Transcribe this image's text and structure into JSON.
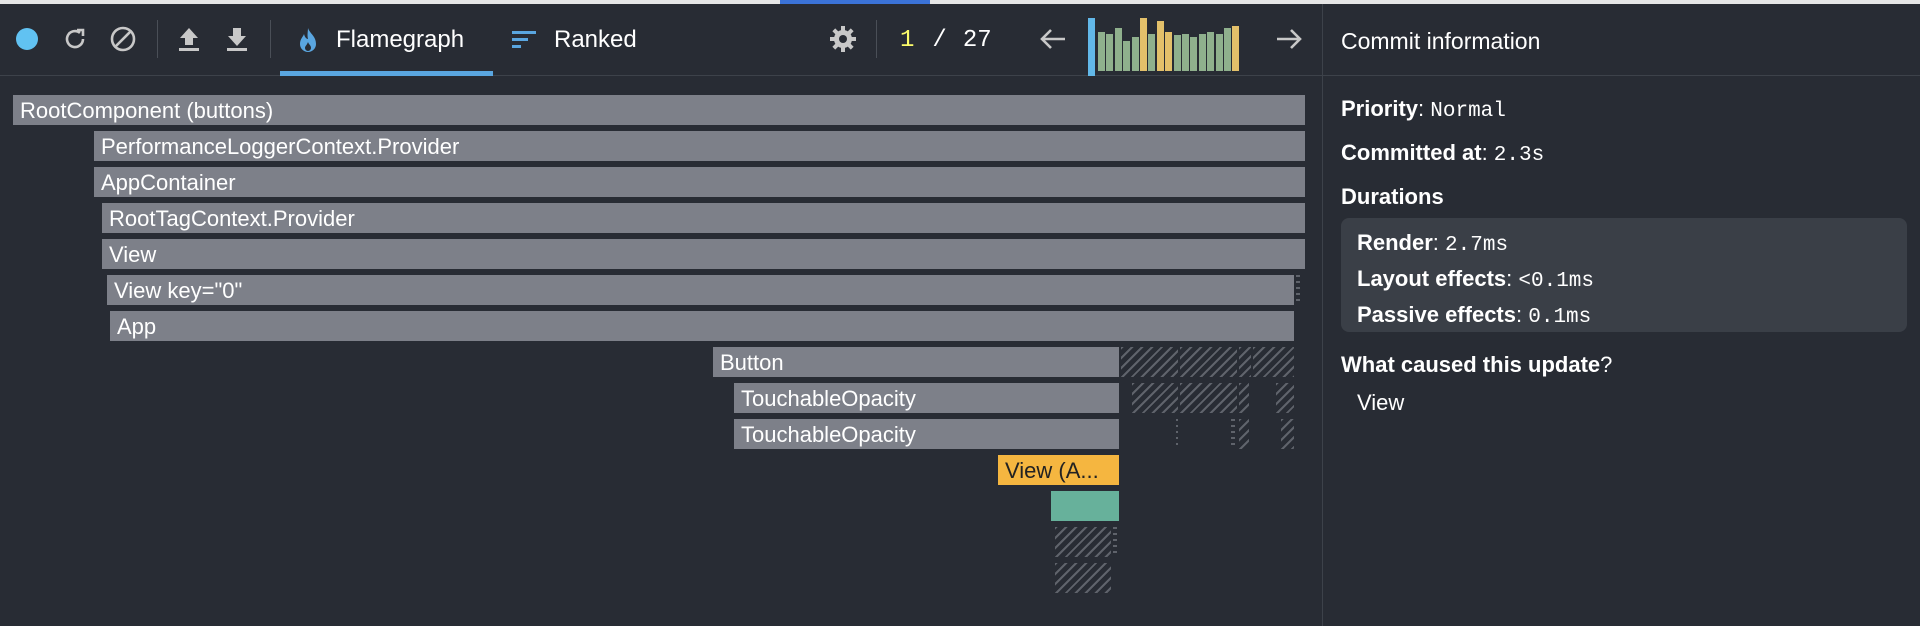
{
  "toolbar": {
    "icons": [
      "record-icon",
      "reload-icon",
      "clear-icon",
      "upload-icon",
      "download-icon",
      "settings-icon",
      "prev-arrow-icon",
      "next-arrow-icon"
    ],
    "tabs": [
      {
        "label": "Flamegraph",
        "icon": "flame-icon",
        "active": true
      },
      {
        "label": "Ranked",
        "icon": "ranked-icon",
        "active": false
      }
    ],
    "commit_current": "1",
    "commit_sep": "/",
    "commit_total": "27"
  },
  "commit_chart": {
    "colors": {
      "green": "#8fb08d",
      "yellow": "#e3c06a",
      "selected": "#62b8e8"
    },
    "bars": [
      {
        "v": 0.74,
        "c": "green"
      },
      {
        "v": 0.7,
        "c": "green"
      },
      {
        "v": 0.82,
        "c": "green"
      },
      {
        "v": 0.56,
        "c": "green"
      },
      {
        "v": 0.65,
        "c": "green"
      },
      {
        "v": 1.0,
        "c": "yellow"
      },
      {
        "v": 0.7,
        "c": "green"
      },
      {
        "v": 0.94,
        "c": "yellow"
      },
      {
        "v": 0.74,
        "c": "yellow"
      },
      {
        "v": 0.68,
        "c": "green"
      },
      {
        "v": 0.7,
        "c": "green"
      },
      {
        "v": 0.65,
        "c": "green"
      },
      {
        "v": 0.7,
        "c": "green"
      },
      {
        "v": 0.74,
        "c": "green"
      },
      {
        "v": 0.7,
        "c": "green"
      },
      {
        "v": 0.82,
        "c": "green"
      },
      {
        "v": 0.85,
        "c": "yellow"
      }
    ]
  },
  "flamegraph": {
    "nodes": [
      {
        "label": "RootComponent (buttons)",
        "type": "normal"
      },
      {
        "label": "PerformanceLoggerContext.Provider",
        "type": "normal"
      },
      {
        "label": "AppContainer",
        "type": "normal"
      },
      {
        "label": "RootTagContext.Provider",
        "type": "normal"
      },
      {
        "label": "View",
        "type": "normal"
      },
      {
        "label": "View key=\"0\"",
        "type": "normal"
      },
      {
        "label": "App",
        "type": "normal"
      },
      {
        "label": "Button",
        "type": "normal"
      },
      {
        "label": "TouchableOpacity",
        "type": "normal"
      },
      {
        "label": "TouchableOpacity",
        "type": "normal"
      },
      {
        "label": "View (A...",
        "type": "selected"
      },
      {
        "label": "",
        "type": "green"
      }
    ]
  },
  "panel": {
    "title": "Commit information",
    "priority_label": "Priority",
    "priority_value": "Normal",
    "committed_label": "Committed at",
    "committed_value": "2.3s",
    "durations_label": "Durations",
    "render_label": "Render",
    "render_value": "2.7ms",
    "layout_label": "Layout effects",
    "layout_value": "<0.1ms",
    "passive_label": "Passive effects",
    "passive_value": "0.1ms",
    "cause_label": "What caused this update",
    "cause_item": "View"
  }
}
